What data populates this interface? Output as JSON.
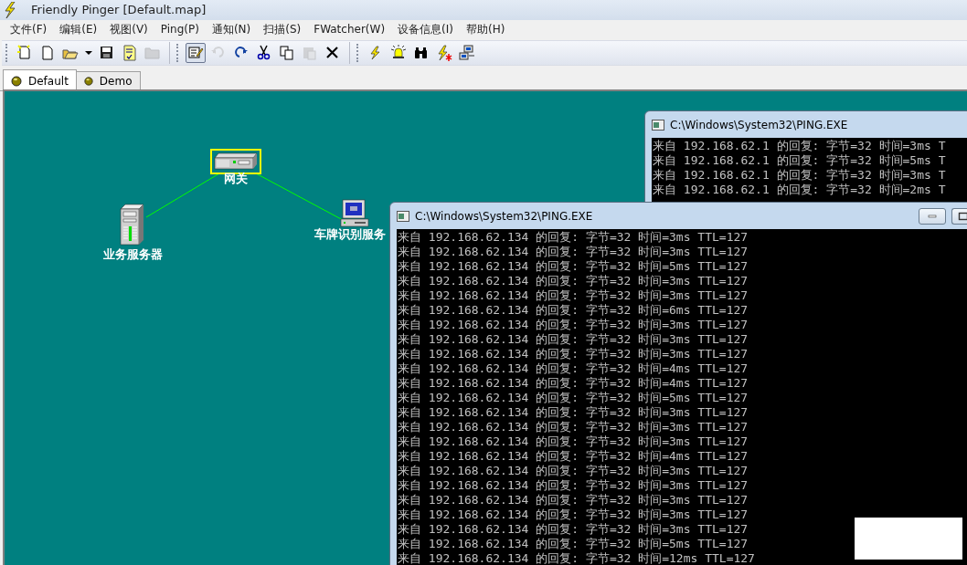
{
  "window": {
    "title": "Friendly Pinger [Default.map]"
  },
  "menu": [
    "文件(F)",
    "编辑(E)",
    "视图(V)",
    "Ping(P)",
    "通知(N)",
    "扫描(S)",
    "FWatcher(W)",
    "设备信息(I)",
    "帮助(H)"
  ],
  "toolbar": [
    [
      {
        "kind": "new-special",
        "disabled": false,
        "pressed": false
      },
      {
        "kind": "new",
        "disabled": false,
        "pressed": false
      },
      {
        "kind": "open",
        "disabled": false,
        "pressed": false
      },
      {
        "kind": "dropdown",
        "disabled": false,
        "pressed": false
      },
      {
        "kind": "save",
        "disabled": false,
        "pressed": false
      },
      {
        "kind": "checklist",
        "disabled": false,
        "pressed": false
      },
      {
        "kind": "folder",
        "disabled": true,
        "pressed": false
      }
    ],
    [
      {
        "kind": "edit",
        "disabled": false,
        "pressed": true
      },
      {
        "kind": "undo",
        "disabled": true,
        "pressed": false
      },
      {
        "kind": "redo",
        "disabled": false,
        "pressed": false
      },
      {
        "kind": "cut",
        "disabled": false,
        "pressed": false
      },
      {
        "kind": "copy",
        "disabled": false,
        "pressed": false
      },
      {
        "kind": "paste",
        "disabled": true,
        "pressed": false
      },
      {
        "kind": "delete",
        "disabled": false,
        "pressed": false
      }
    ],
    [
      {
        "kind": "bolt",
        "disabled": false,
        "pressed": false
      },
      {
        "kind": "bell",
        "disabled": false,
        "pressed": false
      },
      {
        "kind": "binoculars",
        "disabled": false,
        "pressed": false
      },
      {
        "kind": "bolt-star",
        "disabled": false,
        "pressed": false
      },
      {
        "kind": "network",
        "disabled": false,
        "pressed": false
      }
    ]
  ],
  "tabs": [
    {
      "label": "Default",
      "selected": true
    },
    {
      "label": "Demo",
      "selected": false
    }
  ],
  "map": {
    "nodes": [
      {
        "kind": "gateway",
        "label": "网关",
        "selected": true
      },
      {
        "kind": "server",
        "label": "业务服务器",
        "selected": false
      },
      {
        "kind": "pc",
        "label": "车牌识别服务",
        "selected": false
      }
    ]
  },
  "console_back": {
    "title": "C:\\Windows\\System32\\PING.EXE",
    "lines": [
      "来自 192.168.62.1 的回复: 字节=32 时间=3ms T",
      "来自 192.168.62.1 的回复: 字节=32 时间=5ms T",
      "来自 192.168.62.1 的回复: 字节=32 时间=3ms T",
      "来自 192.168.62.1 的回复: 字节=32 时间=2ms T"
    ]
  },
  "console_front": {
    "title": "C:\\Windows\\System32\\PING.EXE",
    "lines": [
      "来自 192.168.62.134 的回复: 字节=32 时间=3ms TTL=127",
      "来自 192.168.62.134 的回复: 字节=32 时间=3ms TTL=127",
      "来自 192.168.62.134 的回复: 字节=32 时间=5ms TTL=127",
      "来自 192.168.62.134 的回复: 字节=32 时间=3ms TTL=127",
      "来自 192.168.62.134 的回复: 字节=32 时间=3ms TTL=127",
      "来自 192.168.62.134 的回复: 字节=32 时间=6ms TTL=127",
      "来自 192.168.62.134 的回复: 字节=32 时间=3ms TTL=127",
      "来自 192.168.62.134 的回复: 字节=32 时间=3ms TTL=127",
      "来自 192.168.62.134 的回复: 字节=32 时间=3ms TTL=127",
      "来自 192.168.62.134 的回复: 字节=32 时间=4ms TTL=127",
      "来自 192.168.62.134 的回复: 字节=32 时间=4ms TTL=127",
      "来自 192.168.62.134 的回复: 字节=32 时间=5ms TTL=127",
      "来自 192.168.62.134 的回复: 字节=32 时间=3ms TTL=127",
      "来自 192.168.62.134 的回复: 字节=32 时间=3ms TTL=127",
      "来自 192.168.62.134 的回复: 字节=32 时间=3ms TTL=127",
      "来自 192.168.62.134 的回复: 字节=32 时间=4ms TTL=127",
      "来自 192.168.62.134 的回复: 字节=32 时间=3ms TTL=127",
      "来自 192.168.62.134 的回复: 字节=32 时间=3ms TTL=127",
      "来自 192.168.62.134 的回复: 字节=32 时间=3ms TTL=127",
      "来自 192.168.62.134 的回复: 字节=32 时间=3ms TTL=127",
      "来自 192.168.62.134 的回复: 字节=32 时间=3ms TTL=127",
      "来自 192.168.62.134 的回复: 字节=32 时间=5ms TTL=127",
      "来自 192.168.62.134 的回复: 字节=32 时间=12ms TTL=127"
    ]
  }
}
